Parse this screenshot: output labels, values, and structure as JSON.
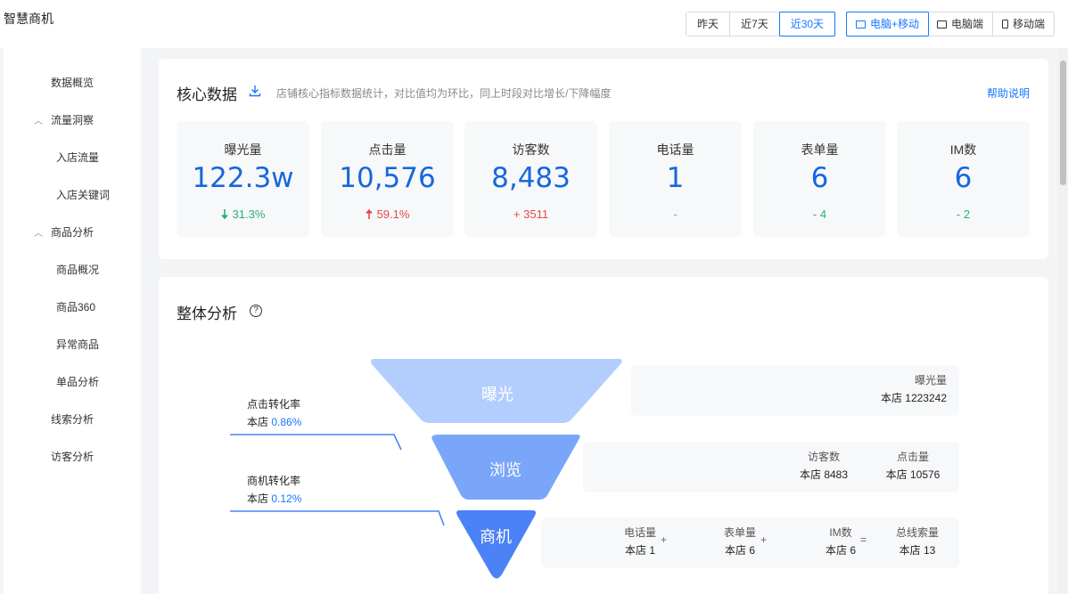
{
  "app": {
    "title": "智慧商机"
  },
  "range": [
    "昨天",
    "近7天",
    "近30天"
  ],
  "device": [
    "电脑+移动",
    "电脑端",
    "移动端"
  ],
  "sidebar": {
    "items": [
      {
        "label": "数据概览"
      },
      {
        "label": "流量洞察"
      },
      {
        "label": "入店流量"
      },
      {
        "label": "入店关键词"
      },
      {
        "label": "商品分析"
      },
      {
        "label": "商品概况"
      },
      {
        "label": "商品360"
      },
      {
        "label": "异常商品"
      },
      {
        "label": "单品分析"
      },
      {
        "label": "线索分析"
      },
      {
        "label": "访客分析"
      }
    ]
  },
  "core": {
    "title": "核心数据",
    "desc": "店铺核心指标数据统计，对比值均为环比，同上时段对比增长/下降幅度",
    "help": "帮助说明",
    "metrics": [
      {
        "label": "曝光量",
        "value": "122.3w",
        "change": "31.3%",
        "trend": "down"
      },
      {
        "label": "点击量",
        "value": "10,576",
        "change": "59.1%",
        "trend": "up"
      },
      {
        "label": "访客数",
        "value": "8,483",
        "change": "+ 3511",
        "trend": "plus"
      },
      {
        "label": "电话量",
        "value": "1",
        "change": "-",
        "trend": "none"
      },
      {
        "label": "表单量",
        "value": "6",
        "change": "- 4",
        "trend": "minus"
      },
      {
        "label": "IM数",
        "value": "6",
        "change": "- 2",
        "trend": "minus"
      }
    ]
  },
  "overall": {
    "title": "整体分析",
    "help_icon": "?",
    "stages": [
      "曝光",
      "浏览",
      "商机"
    ],
    "click_rate": {
      "label": "点击转化率",
      "prefix": "本店",
      "value": "0.86%"
    },
    "lead_rate": {
      "label": "商机转化率",
      "prefix": "本店",
      "value": "0.12%"
    },
    "exposure": {
      "label": "曝光量",
      "value": "本店 1223242"
    },
    "browse": [
      {
        "label": "访客数",
        "value": "本店 8483"
      },
      {
        "label": "点击量",
        "value": "本店 10576"
      }
    ],
    "leads": [
      {
        "label": "电话量",
        "value": "本店 1"
      },
      {
        "label": "表单量",
        "value": "本店 6"
      },
      {
        "label": "IM数",
        "value": "本店 6"
      },
      {
        "label": "总线索量",
        "value": "本店 13"
      }
    ],
    "ops": [
      "+",
      "+",
      "="
    ]
  },
  "colors": {
    "accent": "#1677ff",
    "value": "#1668dc",
    "up": "#e04b4b",
    "down": "#27b07a",
    "funnel_top": "#b3cefd",
    "funnel_mid": "#79a6f8",
    "funnel_bottom": "#4b82f5"
  }
}
